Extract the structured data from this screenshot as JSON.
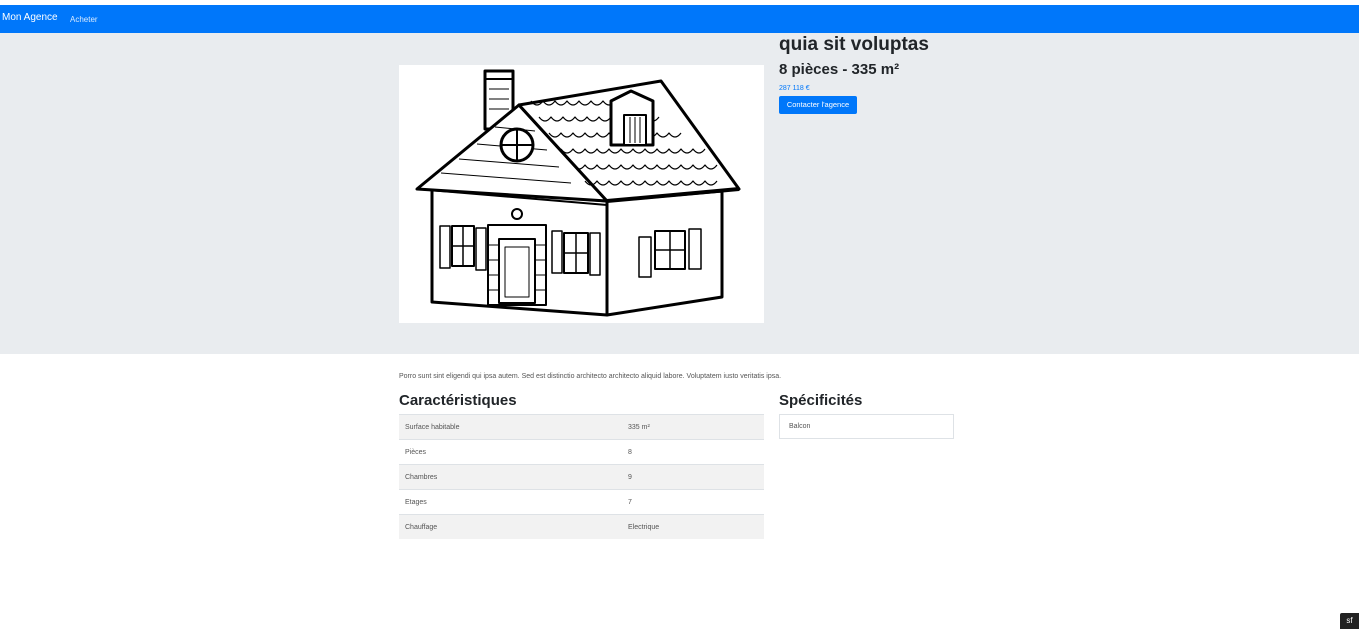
{
  "navbar": {
    "brand": "Mon Agence",
    "links": [
      {
        "label": "Acheter"
      }
    ]
  },
  "property": {
    "title": "quia sit voluptas",
    "subtitle": "8 pièces - 335 m²",
    "price": "287 118 €",
    "contact_label": "Contacter l'agence",
    "image_icon": "house-illustration",
    "description": "Porro sunt sint eligendi qui ipsa autem. Sed est distinctio architecto architecto aliquid labore. Voluptatem iusto veritatis ipsa."
  },
  "characteristics": {
    "heading": "Caractéristiques",
    "rows": [
      {
        "label": "Surface habitable",
        "value": "335 m²"
      },
      {
        "label": "Pièces",
        "value": "8"
      },
      {
        "label": "Chambres",
        "value": "9"
      },
      {
        "label": "Etages",
        "value": "7"
      },
      {
        "label": "Chauffage",
        "value": "Electrique"
      }
    ]
  },
  "specifics": {
    "heading": "Spécificités",
    "items": [
      "Balcon"
    ]
  },
  "debug_toolbar": {
    "icon": "symfony-icon",
    "glyph": "sf"
  },
  "colors": {
    "primary": "#0077fa",
    "hero_background": "#e9ecef",
    "stripe": "#f2f2f2"
  }
}
